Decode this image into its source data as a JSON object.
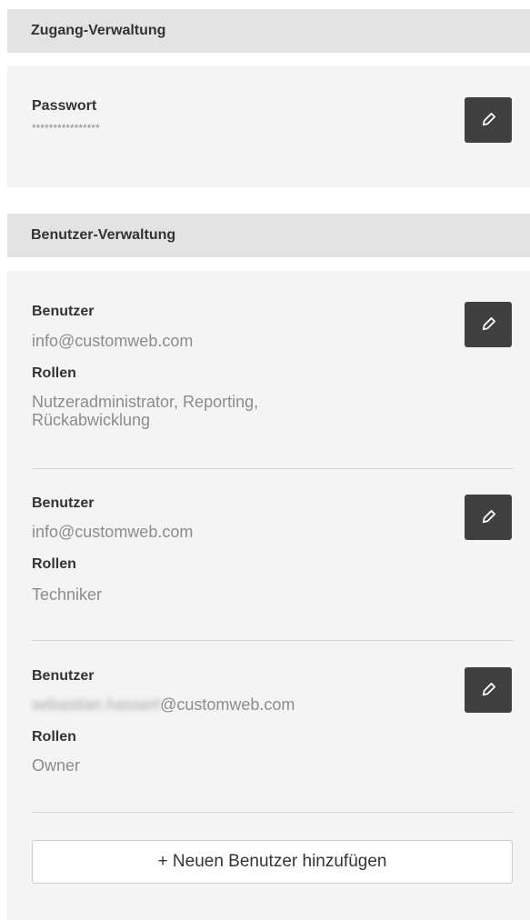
{
  "access": {
    "header": "Zugang-Verwaltung",
    "password_label": "Passwort",
    "password_mask": "****************"
  },
  "users": {
    "header": "Benutzer-Verwaltung",
    "items": [
      {
        "user_label": "Benutzer",
        "email_prefix": "",
        "email": "info@customweb.com",
        "roles_label": "Rollen",
        "roles": "Nutzeradministrator, Reporting, Rückabwicklung"
      },
      {
        "user_label": "Benutzer",
        "email_prefix": "",
        "email": "info@customweb.com",
        "roles_label": "Rollen",
        "roles": "Techniker"
      },
      {
        "user_label": "Benutzer",
        "email_prefix": "sebastian.hassert",
        "email": "@customweb.com",
        "roles_label": "Rollen",
        "roles": "Owner"
      }
    ],
    "add_button": "+ Neuen Benutzer hinzufügen"
  },
  "icons": {
    "edit": "pencil-icon"
  },
  "colors": {
    "header_bg": "#e3e3e3",
    "panel_bg": "#f4f4f4",
    "button_bg": "#404040",
    "text_dark": "#333333",
    "text_muted": "#8c8c8c"
  }
}
